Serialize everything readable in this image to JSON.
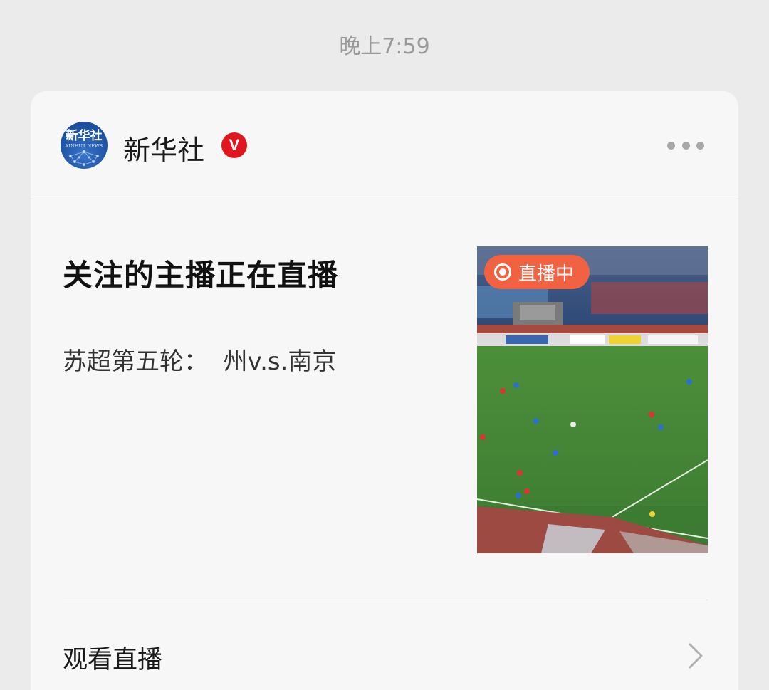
{
  "timestamp": "晚上7:59",
  "card": {
    "account": {
      "name": "新华社",
      "verified_badge": "V",
      "avatar_logo_text": "新华社",
      "avatar_logo_subtext": "XINHUA NEWS"
    },
    "more_icon": "more-icon",
    "headline": "关注的主播正在直播",
    "subtitle": "苏超第五轮：  州v.s.南京",
    "live_badge": "直播中",
    "action_label": "观看直播",
    "colors": {
      "badge_red": "#e0151d",
      "live_orange": "#f06242",
      "avatar_blue": "#1f56a8"
    }
  }
}
